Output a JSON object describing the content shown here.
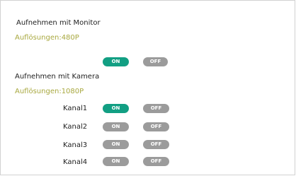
{
  "colors": {
    "on_active": "#129f83",
    "inactive": "#9b9b9b",
    "resolution_text": "#a8a83f"
  },
  "monitor": {
    "title": "Aufnehmen mit Monitor",
    "resolution": "Auflösungen:480P",
    "toggle": {
      "on_label": "ON",
      "off_label": "OFF",
      "state": "on"
    }
  },
  "camera": {
    "title": "Aufnehmen mit Kamera",
    "resolution": "Auflösungen:1080P",
    "channels": [
      {
        "label": "Kanal1",
        "on_label": "ON",
        "off_label": "OFF",
        "state": "on"
      },
      {
        "label": "Kanal2",
        "on_label": "ON",
        "off_label": "OFF",
        "state": "off"
      },
      {
        "label": "Kanal3",
        "on_label": "ON",
        "off_label": "OFF",
        "state": "off"
      },
      {
        "label": "Kanal4",
        "on_label": "ON",
        "off_label": "OFF",
        "state": "off"
      }
    ]
  }
}
